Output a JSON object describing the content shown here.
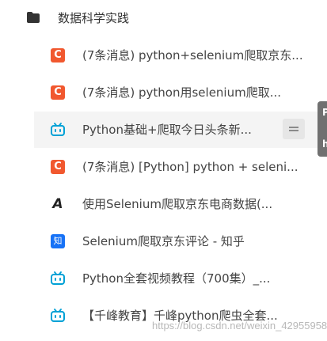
{
  "folder": {
    "icon": "folder-icon",
    "label": "数据科学实践"
  },
  "items": [
    {
      "icon": "csdn-icon",
      "icon_text": "C",
      "label": "(7条消息) python+selenium爬取京东..."
    },
    {
      "icon": "csdn-icon",
      "icon_text": "C",
      "label": "(7条消息) python用selenium爬取..."
    },
    {
      "icon": "bilibili-icon",
      "label": "Python基础+爬取今日头条新..."
    },
    {
      "icon": "csdn-icon",
      "icon_text": "C",
      "label": "(7条消息) [Python] python + seleni..."
    },
    {
      "icon": "jd-icon",
      "icon_text": "A",
      "label": "使用Selenium爬取京东电商数据(..."
    },
    {
      "icon": "zhihu-icon",
      "icon_text": "知",
      "label": "Selenium爬取京东评论 - 知乎"
    },
    {
      "icon": "bilibili-icon",
      "label": "Python全套视频教程（700集）_..."
    },
    {
      "icon": "bilibili-icon",
      "label": "【千峰教育】千峰python爬虫全套..."
    }
  ],
  "tooltip": {
    "line1": "P",
    "line2": "h"
  },
  "watermark": "https://blog.csdn.net/weixin_42955958",
  "colors": {
    "csdn": "#f1582f",
    "zhihu": "#1772f6",
    "bilibili": "#00a1d6",
    "active_row": "#f4f4f4"
  }
}
